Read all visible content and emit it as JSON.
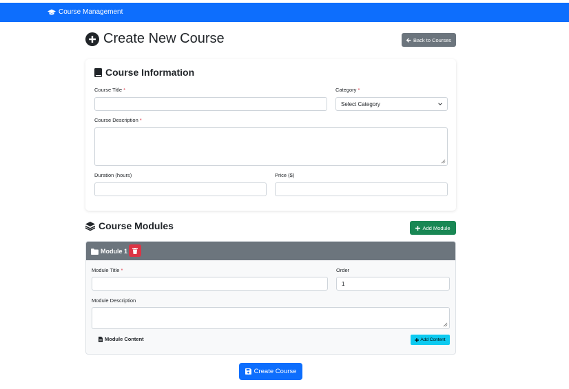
{
  "navbar": {
    "brand": "Course Management"
  },
  "header": {
    "title": "Create New Course",
    "back_button": "Back to Courses"
  },
  "course_info": {
    "title": "Course Information",
    "fields": {
      "course_title": {
        "label": "Course Title",
        "required": "*",
        "value": ""
      },
      "category": {
        "label": "Category",
        "required": "*",
        "selected": "Select Category"
      },
      "description": {
        "label": "Course Description",
        "required": "*",
        "value": ""
      },
      "duration": {
        "label": "Duration (hours)",
        "value": ""
      },
      "price": {
        "label": "Price ($)",
        "value": ""
      }
    }
  },
  "modules": {
    "title": "Course Modules",
    "add_button": "Add Module",
    "items": [
      {
        "header": "Module 1",
        "title_label": "Module Title",
        "title_required": "*",
        "title_value": "",
        "order_label": "Order",
        "order_value": "1",
        "description_label": "Module Description",
        "description_value": "",
        "content_label": "Module Content",
        "add_content_button": "Add Content"
      }
    ]
  },
  "footer": {
    "create_button": "Create Course"
  },
  "icons": {
    "brand": "graduation-cap-icon",
    "title": "plus-circle-icon",
    "back": "arrow-left-icon",
    "course_info": "book-icon",
    "modules": "layers-icon",
    "add_module": "plus-icon",
    "module_header": "folder-icon",
    "delete": "trash-icon",
    "module_content": "file-icon",
    "add_content": "plus-icon",
    "create": "save-icon"
  },
  "colors": {
    "primary": "#0d6efd",
    "secondary": "#6c757d",
    "success": "#198754",
    "danger": "#dc3545",
    "info": "#0dcaf0"
  }
}
